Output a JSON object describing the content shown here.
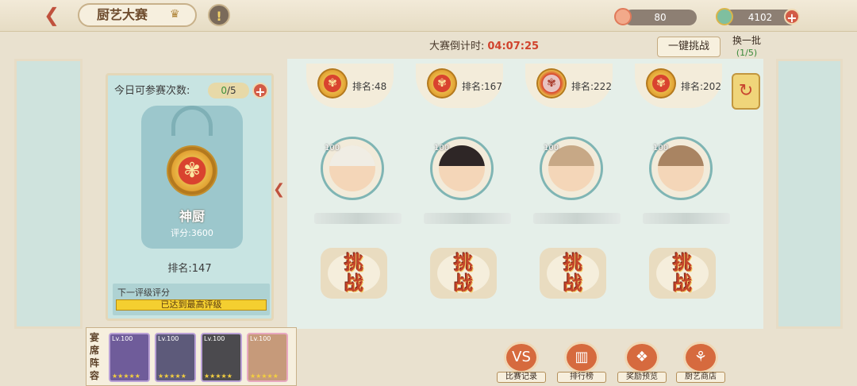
{
  "header": {
    "title": "厨艺大赛",
    "peach_count": "80",
    "coin_count": "4102"
  },
  "timer": {
    "label": "大赛倒计时:",
    "value": "04:07:25"
  },
  "buttons": {
    "one_key": "一键挑战",
    "refresh_label": "换一批",
    "refresh_count": "(1/5)"
  },
  "player": {
    "attempts_label": "今日可参赛次数:",
    "attempts_current": "0",
    "attempts_max": "/5",
    "rank_title": "神厨",
    "score": "评分:3600",
    "rank": "排名:147",
    "next_label": "下一评级评分",
    "next_value": "已达到最高评级"
  },
  "opponents": [
    {
      "rank": "排名:48",
      "level": "100",
      "challenge_top": "挑",
      "challenge_bottom": "战"
    },
    {
      "rank": "排名:167",
      "level": "100",
      "challenge_top": "挑",
      "challenge_bottom": "战"
    },
    {
      "rank": "排名:222",
      "level": "100",
      "challenge_top": "挑",
      "challenge_bottom": "战"
    },
    {
      "rank": "排名:202",
      "level": "100",
      "challenge_top": "挑",
      "challenge_bottom": "战"
    }
  ],
  "lineup": {
    "label": "宴席阵容",
    "cards": [
      {
        "level": "Lv.100"
      },
      {
        "level": "Lv.100"
      },
      {
        "level": "Lv.100"
      },
      {
        "level": "Lv.100"
      }
    ]
  },
  "nav": [
    {
      "label": "比赛记录",
      "icon": "vs-icon"
    },
    {
      "label": "排行榜",
      "icon": "ranking-icon"
    },
    {
      "label": "奖励预览",
      "icon": "reward-icon"
    },
    {
      "label": "厨艺商店",
      "icon": "shop-icon"
    }
  ]
}
